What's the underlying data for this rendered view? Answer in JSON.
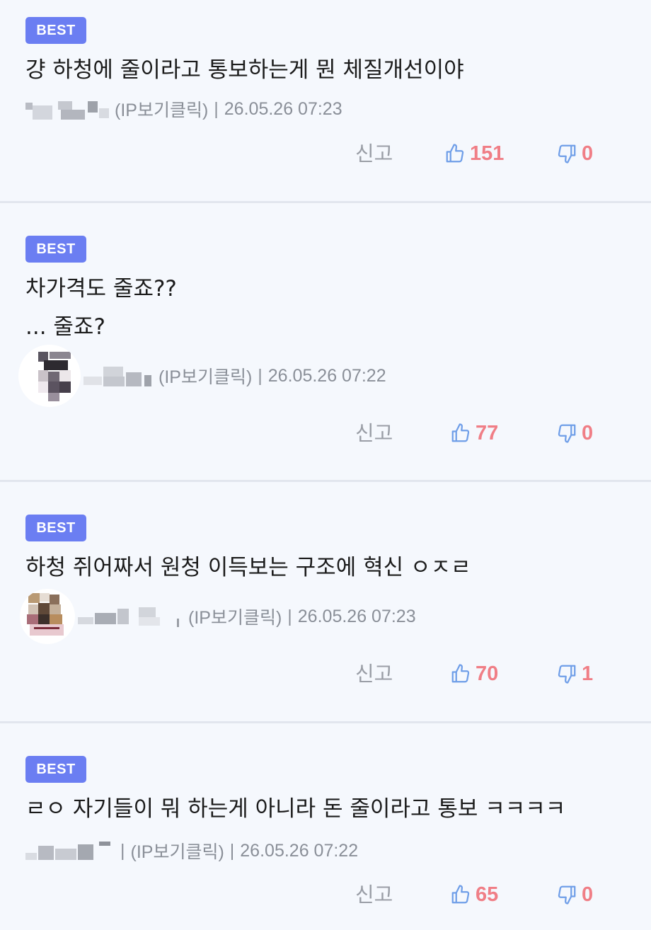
{
  "comments": [
    {
      "badge": "BEST",
      "text_lines": [
        "걍 하청에 줄이라고 통보하는게 뭔 체질개선이야"
      ],
      "ip_label": "(IP보기클릭)",
      "separator": "|",
      "timestamp": "26.05.26 07:23",
      "report_label": "신고",
      "likes": "151",
      "dislikes": "0"
    },
    {
      "badge": "BEST",
      "text_lines": [
        "차가격도 줄죠??",
        "... 줄죠?"
      ],
      "ip_label": "(IP보기클릭)",
      "separator": "|",
      "timestamp": "26.05.26 07:22",
      "report_label": "신고",
      "likes": "77",
      "dislikes": "0"
    },
    {
      "badge": "BEST",
      "text_lines": [
        "하청 쥐어짜서 원청 이득보는 구조에 혁신 ㅇㅈㄹ"
      ],
      "ip_label": "(IP보기클릭)",
      "separator": "|",
      "timestamp": "26.05.26 07:23",
      "report_label": "신고",
      "likes": "70",
      "dislikes": "1"
    },
    {
      "badge": "BEST",
      "text_lines": [
        "ㄹㅇ 자기들이 뭐 하는게 아니라 돈 줄이라고 통보 ㅋㅋㅋㅋ"
      ],
      "ip_label": "(IP보기클릭)",
      "separator": "|",
      "timestamp": "26.05.26 07:22",
      "report_label": "신고",
      "likes": "65",
      "dislikes": "0"
    }
  ],
  "icons": {
    "like": "thumbs-up-icon",
    "dislike": "thumbs-down-icon"
  },
  "colors": {
    "badge": "#6b7ef2",
    "count": "#f07e86",
    "thumb_outline": "#6f9ee8",
    "background": "#f5f8fd"
  }
}
